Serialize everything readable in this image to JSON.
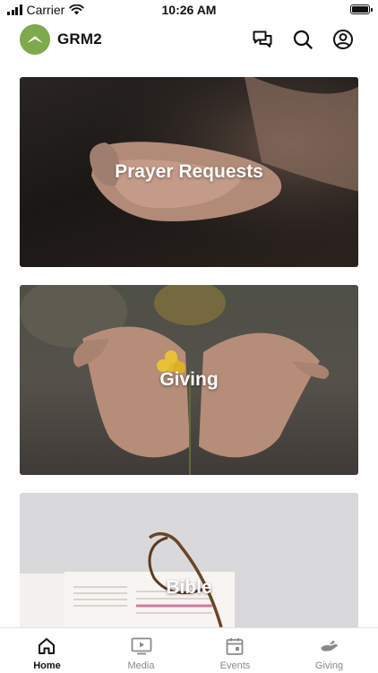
{
  "status_bar": {
    "carrier": "Carrier",
    "time": "10:26 AM"
  },
  "header": {
    "title": "GRM2",
    "icons": [
      "chat-icon",
      "search-icon",
      "account-icon"
    ]
  },
  "cards": [
    {
      "label": "Prayer Requests"
    },
    {
      "label": "Giving"
    },
    {
      "label": "Bible"
    }
  ],
  "tabs": [
    {
      "label": "Home",
      "icon": "home-icon",
      "active": true
    },
    {
      "label": "Media",
      "icon": "media-icon",
      "active": false
    },
    {
      "label": "Events",
      "icon": "calendar-icon",
      "active": false
    },
    {
      "label": "Giving",
      "icon": "giving-icon",
      "active": false
    }
  ],
  "colors": {
    "brand": "#7ea94c",
    "active_tab": "#111111",
    "inactive_tab": "#8a8a8a"
  }
}
